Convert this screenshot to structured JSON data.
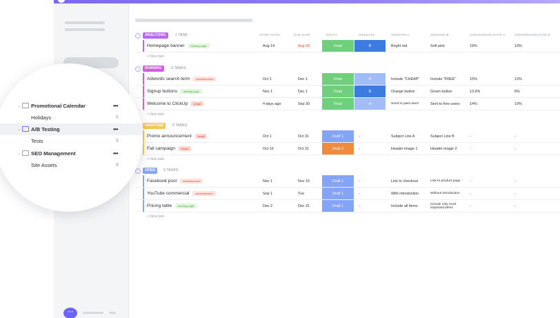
{
  "columns": {
    "start_date": "START DATE",
    "due_date": "DUE DATE",
    "draft": "DRAFT",
    "results": "RESULTS",
    "version_a": "VERSION A",
    "version_b": "VERSION B",
    "conv_a": "CONVERSION RATE A",
    "conv_b": "CONVERSION RATE B"
  },
  "new_task_label": "+ New task",
  "colors": {
    "accent": "#7b68ee",
    "analyzing": "#b86ae6",
    "running": "#d05ce3",
    "drafting": "#f9c74f",
    "open": "#84a4f8",
    "final": "#6fcf7c",
    "draft1": "#84a4f8",
    "draft2": "#f08a3c",
    "result_a": "#a2bcf7",
    "result_b": "#3d7be0"
  },
  "groups": {
    "analyzing": {
      "label": "ANALYZING",
      "count": "1 TASK",
      "rows": [
        {
          "name": "Homepage banner",
          "tag": "landing page",
          "start": "Aug 14",
          "due": "Aug 30",
          "draft": "Final",
          "result": "B",
          "va": "Bright red",
          "vb": "Soft pink",
          "ca": "19%",
          "cb": "13%"
        }
      ]
    },
    "running": {
      "label": "RUNNING",
      "count": "3 TASKS",
      "rows": [
        {
          "name": "Adwords search term",
          "tag": "advertisement",
          "start": "Oct 1",
          "due": "Dec 1",
          "draft": "Final",
          "result": "A",
          "va": "Include \"CHEAP\"",
          "vb": "Include \"FREE\"",
          "ca": "15%",
          "cb": "13%"
        },
        {
          "name": "Signup buttons",
          "tag": "landing page",
          "start": "Nov 1",
          "due": "Dec 1",
          "draft": "Final",
          "result": "B",
          "va": "Orange button",
          "vb": "Green button",
          "ca": "13.6%",
          "cb": "6%"
        },
        {
          "name": "Welcome to ClickUp",
          "tag": "email",
          "start": "4 days ago",
          "due": "Sep 30",
          "draft": "Final",
          "result": "A",
          "va": "Send to paid users",
          "vb": "Sent to free users",
          "ca": "14%",
          "cb": "10%"
        }
      ]
    },
    "drafting": {
      "label": "DRAFTING",
      "count": "2 TASKS",
      "rows": [
        {
          "name": "Promo announcement",
          "tag": "email",
          "start": "Oct 1",
          "due": "Oct 31",
          "draft": "Draft 1",
          "result": "-",
          "va": "Subject Line A",
          "vb": "Subject Line B",
          "ca": "-",
          "cb": "-"
        },
        {
          "name": "Fall campaign",
          "tag": "email",
          "start": "Oct 16",
          "due": "Oct 31",
          "draft": "Draft 2",
          "result": "-",
          "va": "Header image 1",
          "vb": "Header image 2",
          "ca": "-",
          "cb": "-"
        }
      ]
    },
    "open": {
      "label": "OPEN",
      "count": "3 TASKS",
      "rows": [
        {
          "name": "Facebook post",
          "tag": "advertisement",
          "start": "Nov 1",
          "due": "Nov 15",
          "draft": "Draft 1",
          "result": "-",
          "va": "Link to checkout",
          "vb": "Link to product page",
          "ca": "-",
          "cb": "-"
        },
        {
          "name": "YouTube commercial",
          "tag": "advertisement",
          "start": "Sep 1",
          "due": "Tue",
          "draft": "Draft 1",
          "result": "-",
          "va": "With introduction",
          "vb": "Without introduction",
          "ca": "-",
          "cb": "-"
        },
        {
          "name": "Pricing table",
          "tag": "landing page",
          "start": "Dec 2",
          "due": "Dec 31",
          "draft": "Draft 1",
          "result": "-",
          "va": "Include all items",
          "vb": "Include only most important items",
          "ca": "-",
          "cb": "-"
        }
      ]
    }
  },
  "sidebar_overlay": {
    "promotional_calendar": "Promotional Calendar",
    "holidays": "Holidays",
    "holidays_count": "6",
    "ab_testing": "A/B Testing",
    "tests": "Tests",
    "tests_count": "9",
    "seo_management": "SEO Management",
    "site_assets": "Site Assets",
    "site_assets_count": "8",
    "more": "•••"
  }
}
